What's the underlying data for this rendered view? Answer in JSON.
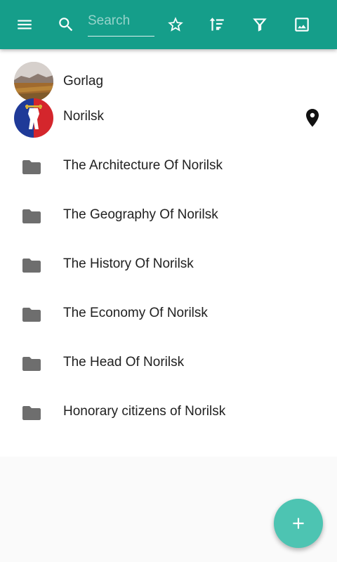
{
  "toolbar": {
    "background": "#159e8a",
    "menu_icon": "menu-icon",
    "search_icon": "search-icon",
    "search_placeholder": "Search",
    "search_value": "",
    "actions": [
      "star-icon",
      "sort-icon",
      "filter-icon",
      "image-icon"
    ]
  },
  "list": {
    "items": [
      {
        "label": "Gorlag",
        "icon": "landscape-avatar"
      },
      {
        "label": "Norilsk",
        "icon": "coat-of-arms-avatar",
        "trailing_icon": "location-pin-icon"
      },
      {
        "label": "The Architecture Of Norilsk",
        "icon": "folder-icon"
      },
      {
        "label": "The Geography Of Norilsk",
        "icon": "folder-icon"
      },
      {
        "label": "The History Of Norilsk",
        "icon": "folder-icon"
      },
      {
        "label": "The Economy Of Norilsk",
        "icon": "folder-icon"
      },
      {
        "label": "The Head Of Norilsk",
        "icon": "folder-icon"
      },
      {
        "label": "Honorary citizens of Norilsk",
        "icon": "folder-icon"
      }
    ]
  },
  "fab": {
    "icon": "add-icon",
    "color": "#4dc4b2"
  }
}
